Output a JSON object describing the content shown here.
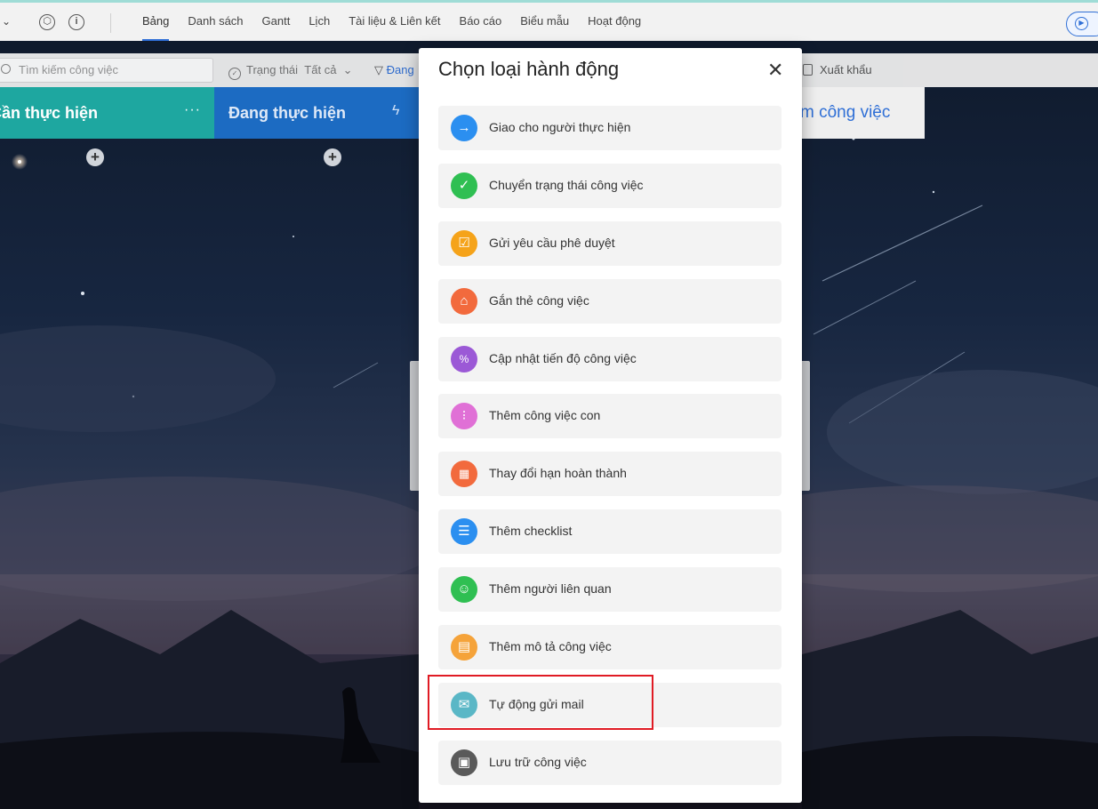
{
  "topbar": {
    "tabs": [
      {
        "label": "Bảng",
        "active": true
      },
      {
        "label": "Danh sách",
        "active": false
      },
      {
        "label": "Gantt",
        "active": false
      },
      {
        "label": "Lịch",
        "active": false
      },
      {
        "label": "Tài liệu & Liên kết",
        "active": false
      },
      {
        "label": "Báo cáo",
        "active": false
      },
      {
        "label": "Biểu mẫu",
        "active": false
      },
      {
        "label": "Hoạt động",
        "active": false
      }
    ],
    "icons": [
      "chevron-down-icon",
      "settings-icon",
      "info-icon",
      "play-icon"
    ]
  },
  "toolbar": {
    "search_placeholder": "Tìm kiếm công việc",
    "status_label": "Trạng thái",
    "status_value": "Tất cả",
    "filter_label": "Đang",
    "export_label": "Xuất khẩu"
  },
  "columns": [
    {
      "title": "Cần thực hiện",
      "color": "#1ea7a0"
    },
    {
      "title": "Đang thực hiện",
      "color": "#1c6bc2"
    },
    {
      "title": "m công việc",
      "color": "#efefef"
    }
  ],
  "modal": {
    "title": "Chọn loại hành động",
    "close_icon": "close-icon",
    "options": [
      {
        "label": "Giao cho người thực hiện",
        "icon": "arrow-right-icon",
        "color": "#2b8ff0"
      },
      {
        "label": "Chuyển trạng thái công việc",
        "icon": "check-icon",
        "color": "#2fbf52"
      },
      {
        "label": "Gửi yêu cầu phê duyệt",
        "icon": "approval-icon",
        "color": "#f5a31a"
      },
      {
        "label": "Gắn thẻ công việc",
        "icon": "tag-icon",
        "color": "#f26a3d"
      },
      {
        "label": "Cập nhật tiến độ công việc",
        "icon": "percent-icon",
        "color": "#9b59d6"
      },
      {
        "label": "Thêm công việc con",
        "icon": "subtask-icon",
        "color": "#e070d6"
      },
      {
        "label": "Thay đổi hạn hoàn thành",
        "icon": "calendar-icon",
        "color": "#f26a3d"
      },
      {
        "label": "Thêm checklist",
        "icon": "checklist-icon",
        "color": "#2b8ff0"
      },
      {
        "label": "Thêm người liên quan",
        "icon": "users-icon",
        "color": "#2fbf52"
      },
      {
        "label": "Thêm mô tả công việc",
        "icon": "document-icon",
        "color": "#f5a33a"
      },
      {
        "label": "Tự động gửi mail",
        "icon": "mail-icon",
        "color": "#5ab7c6"
      },
      {
        "label": "Lưu trữ công việc",
        "icon": "archive-icon",
        "color": "#5a5a5a"
      }
    ],
    "highlighted_option": "Tự động gửi mail",
    "highlight_color": "#e01b24"
  }
}
